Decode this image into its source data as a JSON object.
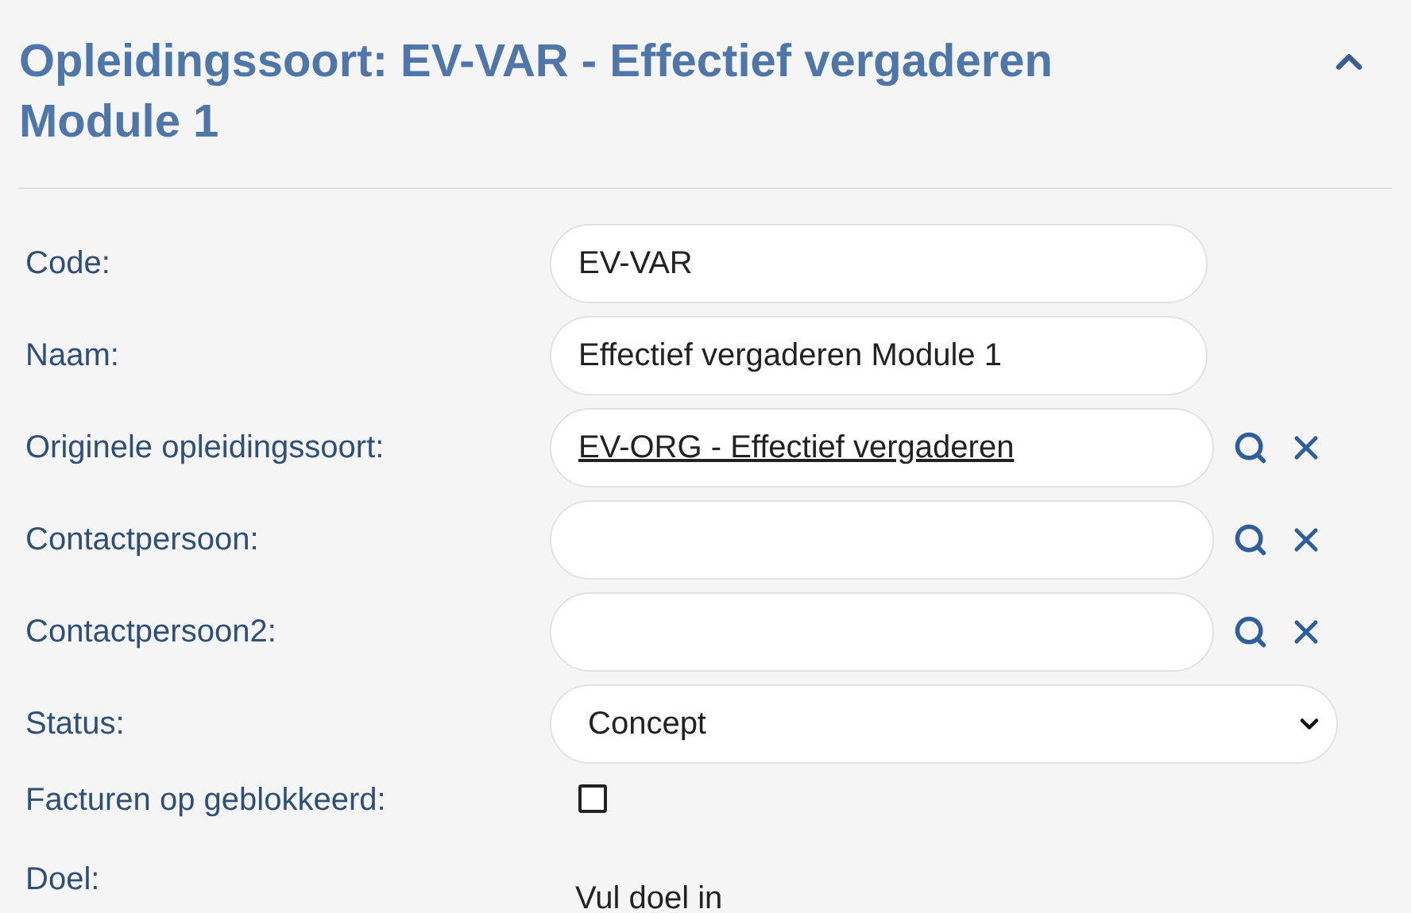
{
  "panel": {
    "title": "Opleidingssoort: EV-VAR - Effectief vergaderen Module 1",
    "expanded": true
  },
  "fields": [
    {
      "kind": "text",
      "label": "Code:",
      "value": "EV-VAR"
    },
    {
      "kind": "text",
      "label": "Naam:",
      "value": "Effectief vergaderen Module 1"
    },
    {
      "kind": "lookup",
      "label": "Originele opleidingssoort:",
      "value": "EV-ORG - Effectief vergaderen"
    },
    {
      "kind": "lookup",
      "label": "Contactpersoon:"
    },
    {
      "kind": "lookup",
      "label": "Contactpersoon2:"
    },
    {
      "kind": "select",
      "label": "Status:",
      "value": "Concept"
    },
    {
      "kind": "checkbox",
      "label": "Facturen op geblokkeerd:",
      "checked": false
    },
    {
      "kind": "editor",
      "label": "Doel:",
      "placeholder": "Vul doel in"
    }
  ]
}
